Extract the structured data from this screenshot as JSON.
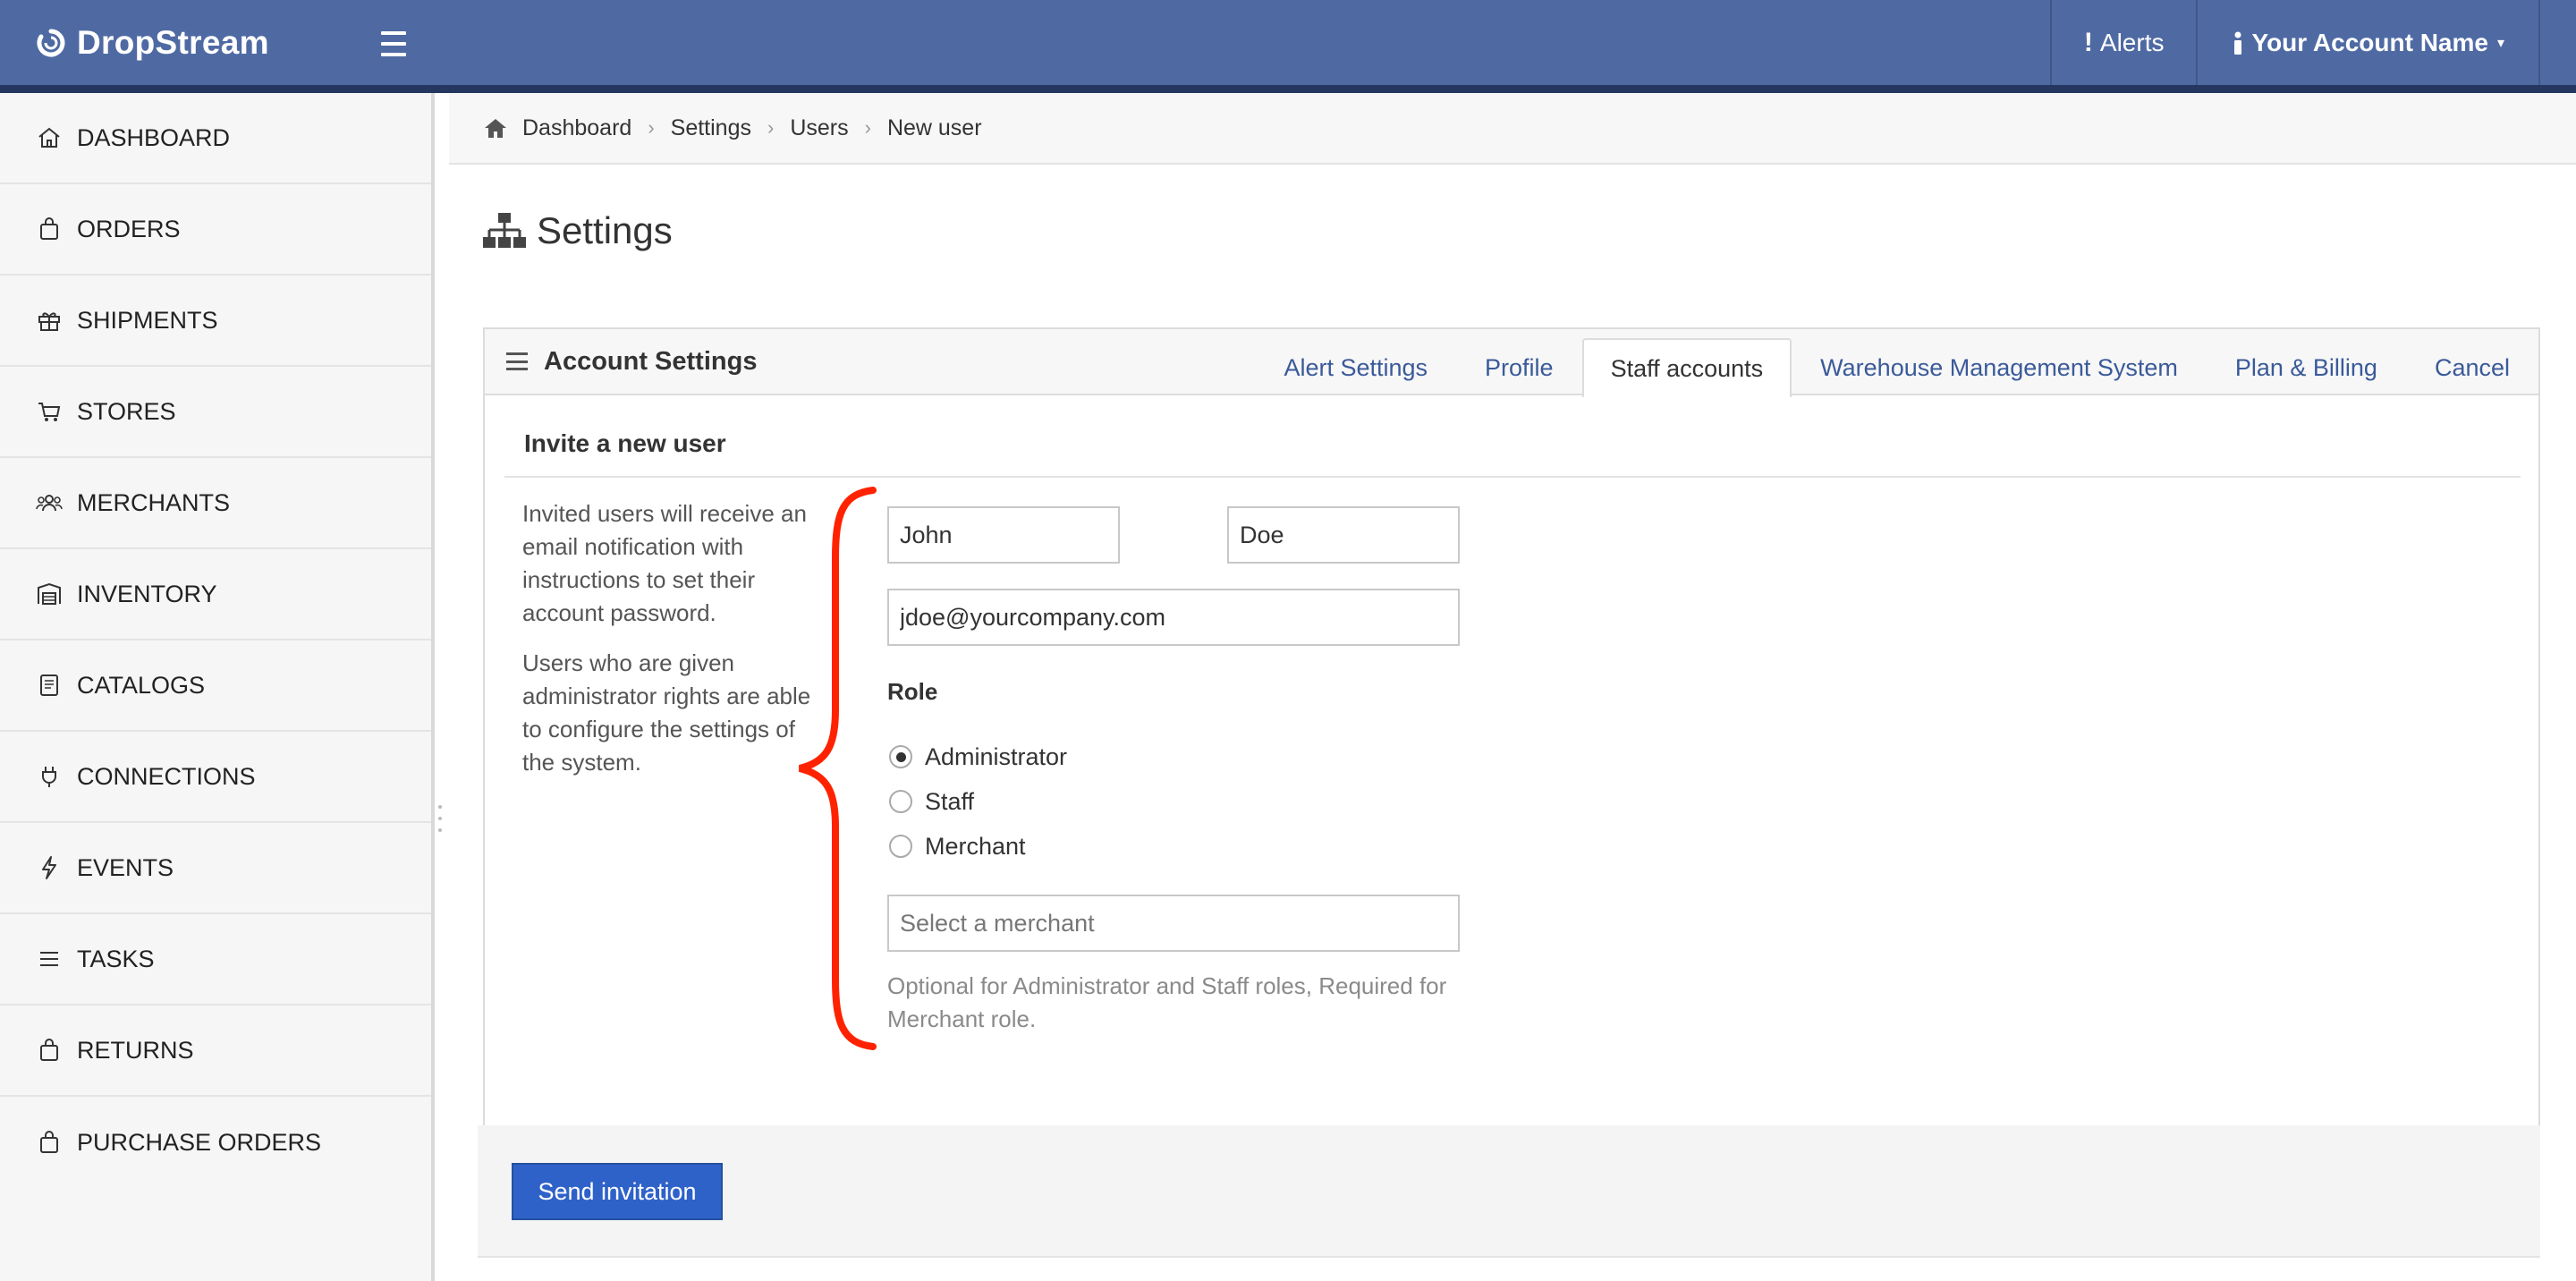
{
  "app": {
    "brand": "DropStream",
    "top_right": {
      "alerts_label": "Alerts",
      "account_label": "Your Account Name"
    }
  },
  "sidebar": {
    "items": [
      {
        "label": "DASHBOARD",
        "icon": "home-icon"
      },
      {
        "label": "ORDERS",
        "icon": "bag-icon"
      },
      {
        "label": "SHIPMENTS",
        "icon": "gift-icon"
      },
      {
        "label": "STORES",
        "icon": "cart-icon"
      },
      {
        "label": "MERCHANTS",
        "icon": "users-icon"
      },
      {
        "label": "INVENTORY",
        "icon": "warehouse-icon"
      },
      {
        "label": "CATALOGS",
        "icon": "book-icon"
      },
      {
        "label": "CONNECTIONS",
        "icon": "plug-icon"
      },
      {
        "label": "EVENTS",
        "icon": "bolt-icon"
      },
      {
        "label": "TASKS",
        "icon": "list-icon"
      },
      {
        "label": "RETURNS",
        "icon": "bag-icon"
      },
      {
        "label": "PURCHASE ORDERS",
        "icon": "bag-icon"
      }
    ]
  },
  "breadcrumb": [
    "Dashboard",
    "Settings",
    "Users",
    "New user"
  ],
  "page": {
    "title": "Settings"
  },
  "panel": {
    "title": "Account Settings",
    "tabs": [
      {
        "label": "Alert Settings",
        "active": false
      },
      {
        "label": "Profile",
        "active": false
      },
      {
        "label": "Staff accounts",
        "active": true
      },
      {
        "label": "Warehouse Management System",
        "active": false
      },
      {
        "label": "Plan & Billing",
        "active": false
      },
      {
        "label": "Cancel",
        "active": false
      }
    ]
  },
  "form": {
    "section_title": "Invite a new user",
    "help": [
      "Invited users will receive an email notification with instructions to set their account password.",
      "Users who are given administrator rights are able to configure the settings of the system."
    ],
    "first_name": "John",
    "last_name": "Doe",
    "email": "jdoe@yourcompany.com",
    "role_label": "Role",
    "roles": [
      {
        "label": "Administrator",
        "checked": true
      },
      {
        "label": "Staff",
        "checked": false
      },
      {
        "label": "Merchant",
        "checked": false
      }
    ],
    "merchant_placeholder": "Select a merchant",
    "merchant_hint": "Optional for Administrator and Staff roles, Required for Merchant role.",
    "submit_label": "Send invitation"
  },
  "colors": {
    "topbar": "#4f6aa3",
    "topbar_border": "#253760",
    "link": "#3a5a99",
    "primary_button": "#2f62c9",
    "annotation_brace": "#ff2200"
  }
}
